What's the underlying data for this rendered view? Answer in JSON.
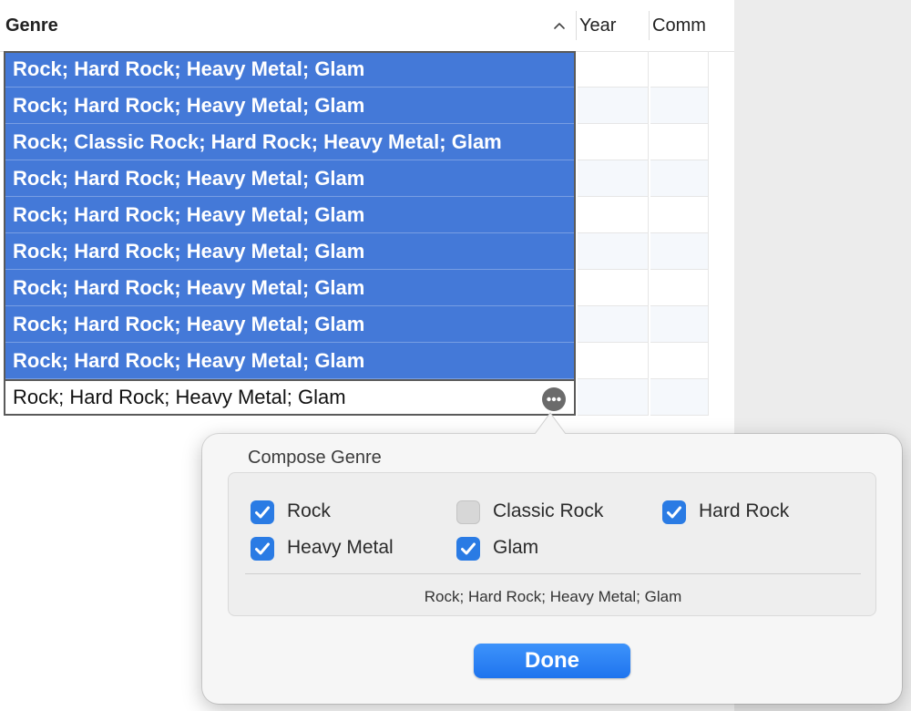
{
  "table": {
    "columns": {
      "genre": "Genre",
      "year": "Year",
      "comments": "Comm"
    },
    "rows": [
      {
        "genre": "Rock; Hard Rock; Heavy Metal; Glam",
        "selected": true
      },
      {
        "genre": "Rock; Hard Rock; Heavy Metal; Glam",
        "selected": true
      },
      {
        "genre": "Rock; Classic Rock; Hard Rock; Heavy Metal; Glam",
        "selected": true
      },
      {
        "genre": "Rock; Hard Rock; Heavy Metal; Glam",
        "selected": true
      },
      {
        "genre": "Rock; Hard Rock; Heavy Metal; Glam",
        "selected": true
      },
      {
        "genre": "Rock; Hard Rock; Heavy Metal; Glam",
        "selected": true
      },
      {
        "genre": "Rock; Hard Rock; Heavy Metal; Glam",
        "selected": true
      },
      {
        "genre": "Rock; Hard Rock; Heavy Metal; Glam",
        "selected": true
      },
      {
        "genre": "Rock; Hard Rock; Heavy Metal; Glam",
        "selected": true
      },
      {
        "genre": "Rock; Hard Rock; Heavy Metal; Glam",
        "selected": false,
        "editing": true
      }
    ],
    "sort_icon": "chevron-up-icon",
    "more_icon": "ellipsis-circle-icon"
  },
  "popover": {
    "title": "Compose Genre",
    "options": [
      {
        "label": "Rock",
        "checked": true
      },
      {
        "label": "Classic Rock",
        "checked": false
      },
      {
        "label": "Hard Rock",
        "checked": true
      },
      {
        "label": "Heavy Metal",
        "checked": true
      },
      {
        "label": "Glam",
        "checked": true
      }
    ],
    "result": "Rock; Hard Rock; Heavy Metal; Glam",
    "done_label": "Done"
  },
  "colors": {
    "selection": "#4479d8",
    "accent": "#2a7be4",
    "done_button": "#1f74ee"
  }
}
